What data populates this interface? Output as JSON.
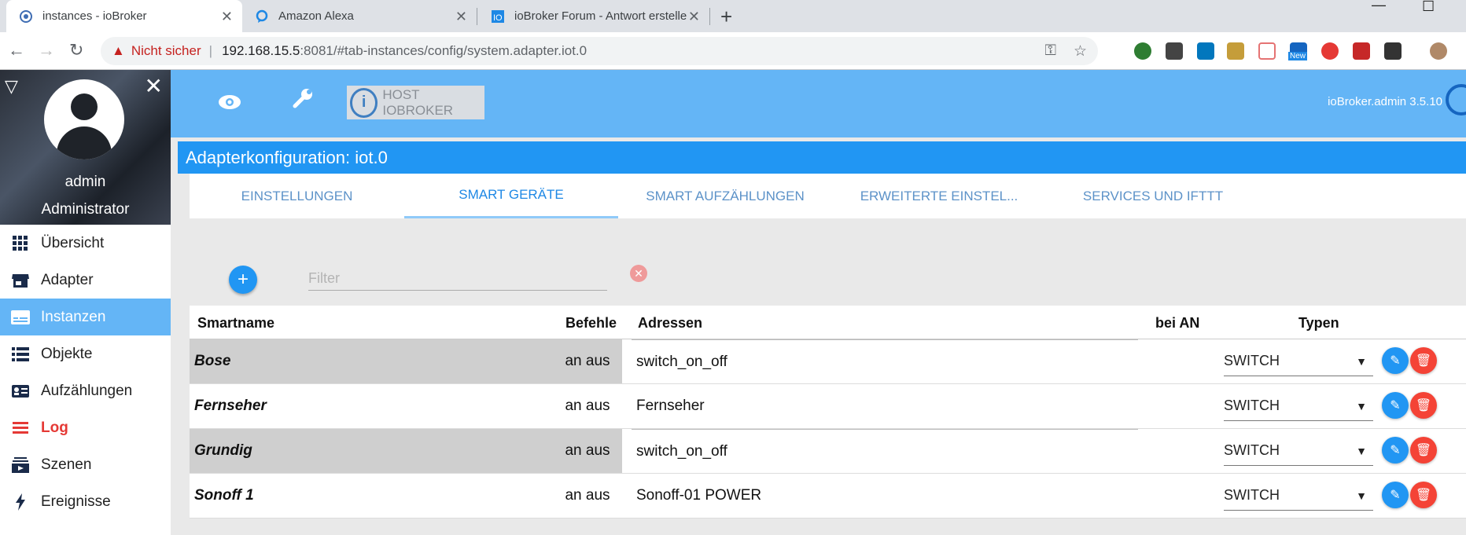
{
  "browser": {
    "tabs": [
      {
        "title": "instances - ioBroker"
      },
      {
        "title": "Amazon Alexa"
      },
      {
        "title": "ioBroker Forum - Antwort erstelle"
      }
    ],
    "new_tab": "+",
    "window_minimize": "—",
    "window_maximize": "☐",
    "not_secure": "Nicht sicher",
    "url_host": "192.168.15.5",
    "url_path": ":8081/#tab-instances/config/system.adapter.iot.0",
    "new_badge": "New"
  },
  "user": {
    "name": "admin",
    "role": "Administrator"
  },
  "menu": [
    {
      "label": "Übersicht",
      "icon": "grid-icon"
    },
    {
      "label": "Adapter",
      "icon": "store-icon"
    },
    {
      "label": "Instanzen",
      "icon": "instances-icon",
      "active": true
    },
    {
      "label": "Objekte",
      "icon": "list-icon"
    },
    {
      "label": "Aufzählungen",
      "icon": "enum-icon"
    },
    {
      "label": "Log",
      "icon": "log-icon"
    },
    {
      "label": "Szenen",
      "icon": "scenes-icon"
    },
    {
      "label": "Ereignisse",
      "icon": "bolt-icon"
    }
  ],
  "appbar": {
    "host_label": "HOST IOBROKER",
    "host_logo": "i",
    "version": "ioBroker.admin 3.5.10"
  },
  "config": {
    "title": "Adapterkonfiguration: iot.0",
    "tabs": [
      "EINSTELLUNGEN",
      "SMART GERÄTE",
      "SMART AUFZÄHLUNGEN",
      "ERWEITERTE EINSTEL...",
      "SERVICES UND IFTTT"
    ],
    "active_tab": "SMART GERÄTE",
    "filter_placeholder": "Filter"
  },
  "table": {
    "headers": {
      "smartname": "Smartname",
      "befehle": "Befehle",
      "adressen": "Adressen",
      "bei_an": "bei AN",
      "typen": "Typen"
    },
    "rows": [
      {
        "name": "Bose",
        "commands": "an aus",
        "address": "switch_on_off",
        "type": "SWITCH",
        "highlighted": true
      },
      {
        "name": "Fernseher",
        "commands": "an aus",
        "address": "Fernseher",
        "type": "SWITCH",
        "highlighted": false
      },
      {
        "name": "Grundig",
        "commands": "an aus",
        "address": "switch_on_off",
        "type": "SWITCH",
        "highlighted": true
      },
      {
        "name": "Sonoff 1",
        "commands": "an aus",
        "address": "Sonoff-01 POWER",
        "type": "SWITCH",
        "highlighted": false
      }
    ]
  },
  "colors": {
    "appbar": "#64b5f6",
    "title_bar": "#2196f3",
    "edit": "#2196f3",
    "delete": "#f44336",
    "log": "#e53935"
  }
}
